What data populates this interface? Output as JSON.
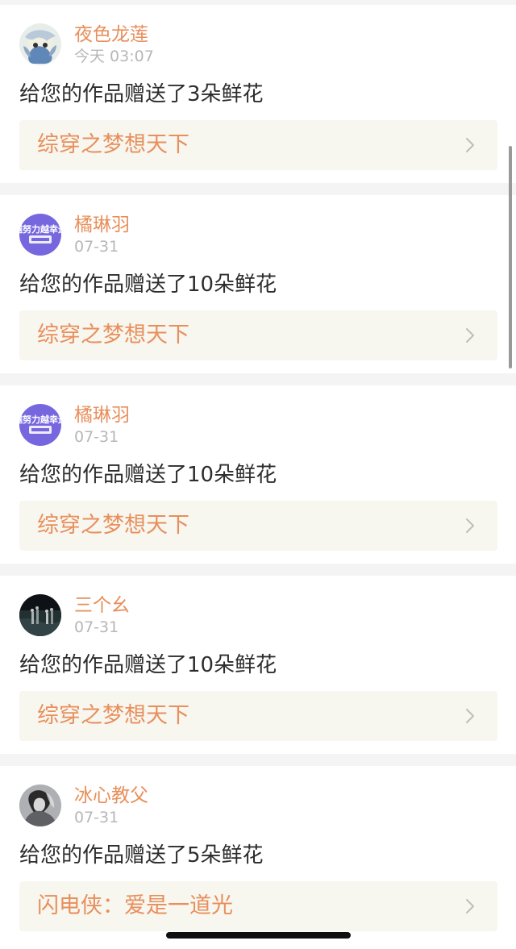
{
  "notifications": [
    {
      "username": "夜色龙莲",
      "time": "今天 03:07",
      "message": "给您的作品赠送了3朵鲜花",
      "work_title": "综穿之梦想天下",
      "avatar_icon": "anime-character-avatar-icon"
    },
    {
      "username": "橘琳羽",
      "time": "07-31",
      "message": "给您的作品赠送了10朵鲜花",
      "work_title": "综穿之梦想天下",
      "avatar_icon": "purple-logo-avatar-icon",
      "avatar_text": "越努力越幸运"
    },
    {
      "username": "橘琳羽",
      "time": "07-31",
      "message": "给您的作品赠送了10朵鲜花",
      "work_title": "综穿之梦想天下",
      "avatar_icon": "purple-logo-avatar-icon",
      "avatar_text": "越努力越幸运"
    },
    {
      "username": "三个幺",
      "time": "07-31",
      "message": "给您的作品赠送了10朵鲜花",
      "work_title": "综穿之梦想天下",
      "avatar_icon": "dark-scene-avatar-icon"
    },
    {
      "username": "冰心教父",
      "time": "07-31",
      "message": "给您的作品赠送了5朵鲜花",
      "work_title": "闪电侠：爱是一道光",
      "avatar_icon": "grey-portrait-avatar-icon"
    }
  ],
  "colors": {
    "accent": "#e88f5c",
    "muted": "#b7b7b7",
    "text": "#2d2d2d",
    "panel": "#f7f6ef",
    "background": "#f4f4f4"
  }
}
